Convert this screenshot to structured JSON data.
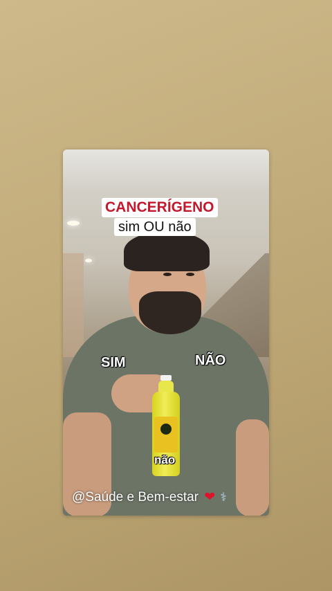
{
  "overlay": {
    "title": "CANCERÍGENO",
    "subtitle": "sim OU não",
    "label_sim": "SIM",
    "label_nao": "NÃO",
    "label_nao_small": "não",
    "handle": "@Saúde e Bem-estar",
    "icons": [
      "heart-icon",
      "stethoscope-icon"
    ]
  },
  "colors": {
    "title_red": "#c4182d",
    "background_gold": "#c4ae7e",
    "bottle_yellow": "#e9e43a"
  }
}
